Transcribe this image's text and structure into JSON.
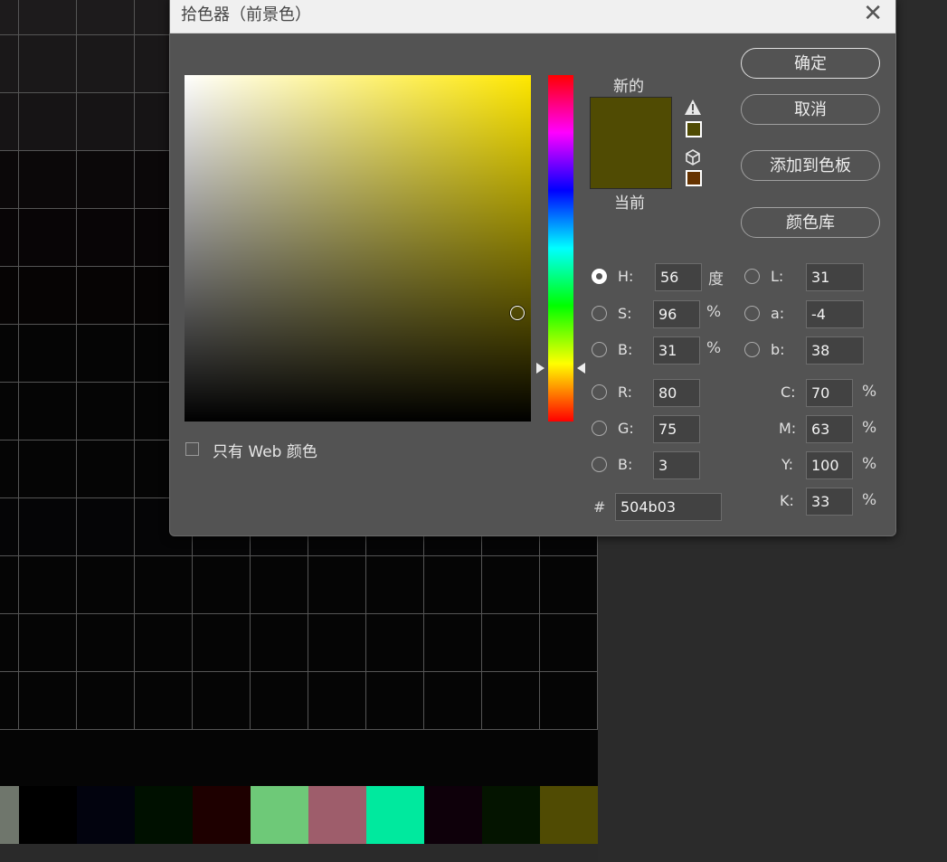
{
  "dialog": {
    "title": "拾色器（前景色）",
    "close_glyph": "✕",
    "label_new": "新的",
    "label_current": "当前",
    "new_color": "#504b03",
    "current_color": "#504b03",
    "gamut_warning_color": "#504b03",
    "web_safe_color": "#663300",
    "buttons": {
      "ok": "确定",
      "cancel": "取消",
      "add_to_swatches": "添加到色板",
      "color_libraries": "颜色库"
    },
    "only_web_colors_label": "只有 Web 颜色",
    "only_web_colors_checked": false,
    "hsb": {
      "h_label": "H:",
      "h_value": "56",
      "h_unit": "度",
      "s_label": "S:",
      "s_value": "96",
      "s_unit": "%",
      "b_label": "B:",
      "b_value": "31",
      "b_unit": "%",
      "selected": "H"
    },
    "lab": {
      "l_label": "L:",
      "l_value": "31",
      "a_label": "a:",
      "a_value": "-4",
      "b_label": "b:",
      "b_value": "38"
    },
    "rgb": {
      "r_label": "R:",
      "r_value": "80",
      "g_label": "G:",
      "g_value": "75",
      "b_label": "B:",
      "b_value": "3"
    },
    "cmyk": {
      "c_label": "C:",
      "c_value": "70",
      "c_unit": "%",
      "m_label": "M:",
      "m_value": "63",
      "m_unit": "%",
      "y_label": "Y:",
      "y_value": "100",
      "y_unit": "%",
      "k_label": "K:",
      "k_value": "33",
      "k_unit": "%"
    },
    "hex_label": "#",
    "hex_value": "504b03"
  },
  "canvas": {
    "swatch_row_colors": [
      "#6f766c",
      "#000000",
      "#02030e",
      "#001000",
      "#1e0000",
      "#6ec978",
      "#9e5d6b",
      "#00e99e",
      "#0e000a",
      "#041400",
      "#504b03"
    ]
  }
}
